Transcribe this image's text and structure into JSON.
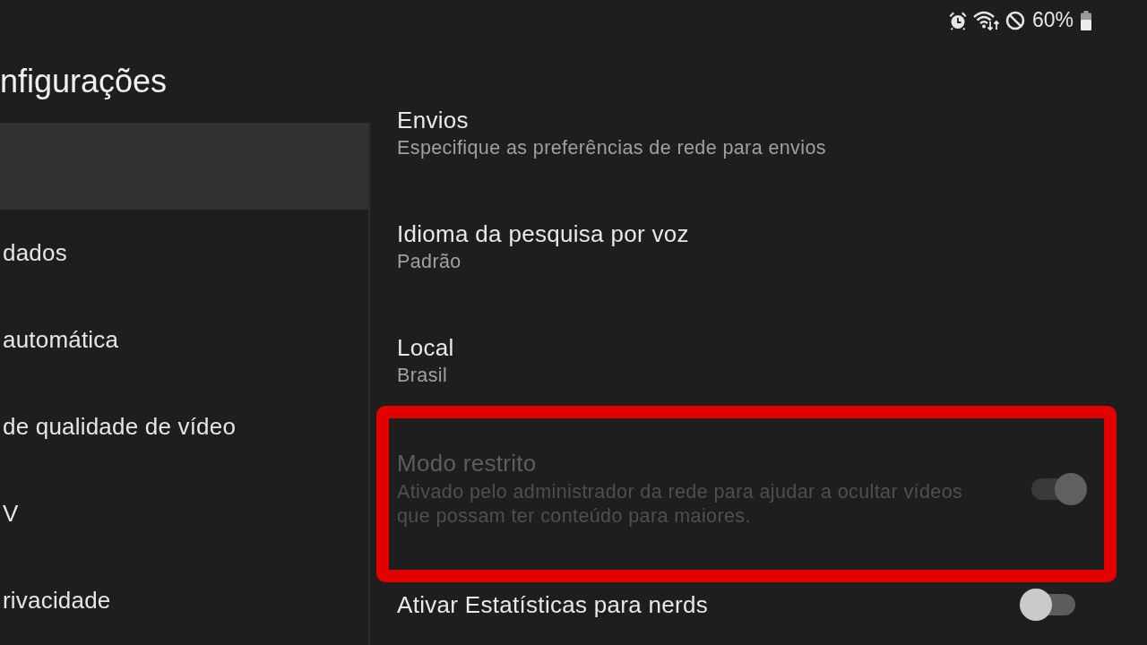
{
  "status_bar": {
    "battery_text": "60%"
  },
  "header": {
    "title": "nfigurações"
  },
  "sidebar": {
    "items": [
      {
        "selected": true
      },
      {
        "label": "dados",
        "selected": false
      },
      {
        "label": "automática",
        "selected": false
      },
      {
        "label": "de qualidade de vídeo",
        "selected": false
      },
      {
        "label": "V",
        "selected": false
      },
      {
        "label": "rivacidade",
        "selected": false
      }
    ]
  },
  "settings": [
    {
      "kind": "info",
      "title": "Envios",
      "subtitle": "Especifique as preferências de rede para envios",
      "disabled": false,
      "highlighted": false
    },
    {
      "kind": "info",
      "title": "Idioma da pesquisa por voz",
      "subtitle": "Padrão",
      "disabled": false,
      "highlighted": false
    },
    {
      "kind": "info",
      "title": "Local",
      "subtitle": "Brasil",
      "disabled": false,
      "highlighted": false
    },
    {
      "kind": "toggle",
      "title": "Modo restrito",
      "subtitle": "Ativado pelo administrador da rede para ajudar a ocultar vídeos que possam ter conteúdo para maiores.",
      "on": true,
      "disabled": true,
      "highlighted": true
    },
    {
      "kind": "toggle",
      "title": "Ativar Estatísticas para nerds",
      "on": false,
      "disabled": false,
      "highlighted": false
    }
  ]
}
